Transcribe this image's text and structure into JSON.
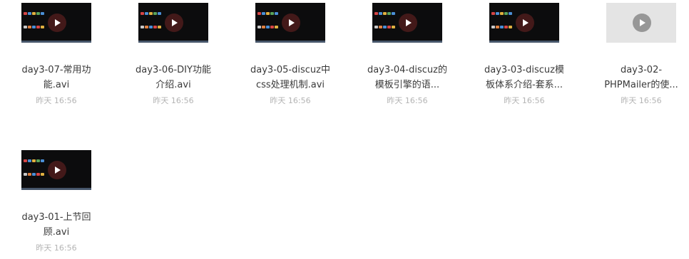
{
  "files": [
    {
      "line1": "day3-07-常用功",
      "line2": "能.avi",
      "time": "昨天 16:56",
      "icon": "play-icon"
    },
    {
      "line1": "day3-06-DIY功能",
      "line2": "介绍.avi",
      "time": "昨天 16:56",
      "icon": "play-icon"
    },
    {
      "line1": "day3-05-discuz中",
      "line2": "css处理机制.avi",
      "time": "昨天 16:56",
      "icon": "play-icon"
    },
    {
      "line1": "day3-04-discuz的",
      "line2": "模板引擎的语...",
      "time": "昨天 16:56",
      "icon": "play-icon"
    },
    {
      "line1": "day3-03-discuz模",
      "line2": "板体系介绍-套系...",
      "time": "昨天 16:56",
      "icon": "play-icon"
    },
    {
      "line1": "day3-02-",
      "line2": "PHPMailer的使...",
      "time": "昨天 16:56",
      "icon": "play-icon"
    },
    {
      "line1": "day3-01-上节回",
      "line2": "顾.avi",
      "time": "昨天 16:56",
      "icon": "play-icon"
    }
  ],
  "colors": {
    "thumbnail_bg": "#0c0c0d",
    "play_button": "#4e1c1c",
    "faded_thumbnail_bg": "#e4e4e4",
    "faded_play_button": "#979797",
    "name_text": "#3a3a3a",
    "time_text": "#b4b4b4"
  }
}
